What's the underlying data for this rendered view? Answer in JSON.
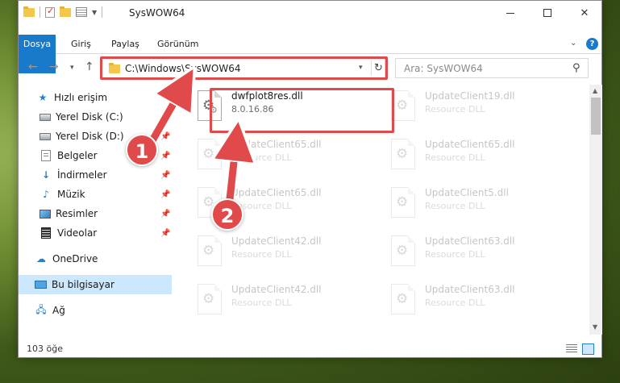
{
  "window": {
    "title": "SysWOW64",
    "controls": {
      "minimize": "—",
      "maximize": "",
      "close": "✕"
    }
  },
  "ribbon": {
    "tabs": [
      "Dosya",
      "Giriş",
      "Paylaş",
      "Görünüm"
    ],
    "help": "?"
  },
  "navbar": {
    "address": "C:\\Windows\\SysWOW64",
    "search_placeholder": "Ara: SysWOW64"
  },
  "sidebar": {
    "items": [
      {
        "label": "Hızlı erişim",
        "icon": "star-icon"
      },
      {
        "label": "Yerel Disk (C:)",
        "icon": "drive-icon"
      },
      {
        "label": "Yerel Disk (D:)",
        "icon": "drive-icon"
      },
      {
        "label": "Belgeler",
        "icon": "document-icon"
      },
      {
        "label": "İndirmeler",
        "icon": "download-icon"
      },
      {
        "label": "Müzik",
        "icon": "music-icon"
      },
      {
        "label": "Resimler",
        "icon": "pictures-icon"
      },
      {
        "label": "Videolar",
        "icon": "video-icon"
      },
      {
        "label": "OneDrive",
        "icon": "cloud-icon"
      },
      {
        "label": "Bu bilgisayar",
        "icon": "computer-icon"
      },
      {
        "label": "Ağ",
        "icon": "network-icon"
      }
    ]
  },
  "files": [
    {
      "name": "dwfplot8res.dll",
      "sub": "8.0.16.86"
    },
    {
      "name": "UpdateClient19.dll",
      "sub": "Resource DLL"
    },
    {
      "name": "UpdateClient65.dll",
      "sub": "Resource DLL"
    },
    {
      "name": "UpdateClient65.dll",
      "sub": "Resource DLL"
    },
    {
      "name": "UpdateClient65.dll",
      "sub": "Resource DLL"
    },
    {
      "name": "UpdateClient5.dll",
      "sub": "Resource DLL"
    },
    {
      "name": "UpdateClient42.dll",
      "sub": "Resource DLL"
    },
    {
      "name": "UpdateClient63.dll",
      "sub": "Resource DLL"
    },
    {
      "name": "UpdateClient42.dll",
      "sub": "Resource DLL"
    },
    {
      "name": "UpdateClient63.dll",
      "sub": "Resource DLL"
    }
  ],
  "status": {
    "count": "103 öğe"
  },
  "annotations": {
    "step1": "1",
    "step2": "2",
    "color": "#e04a4a"
  }
}
